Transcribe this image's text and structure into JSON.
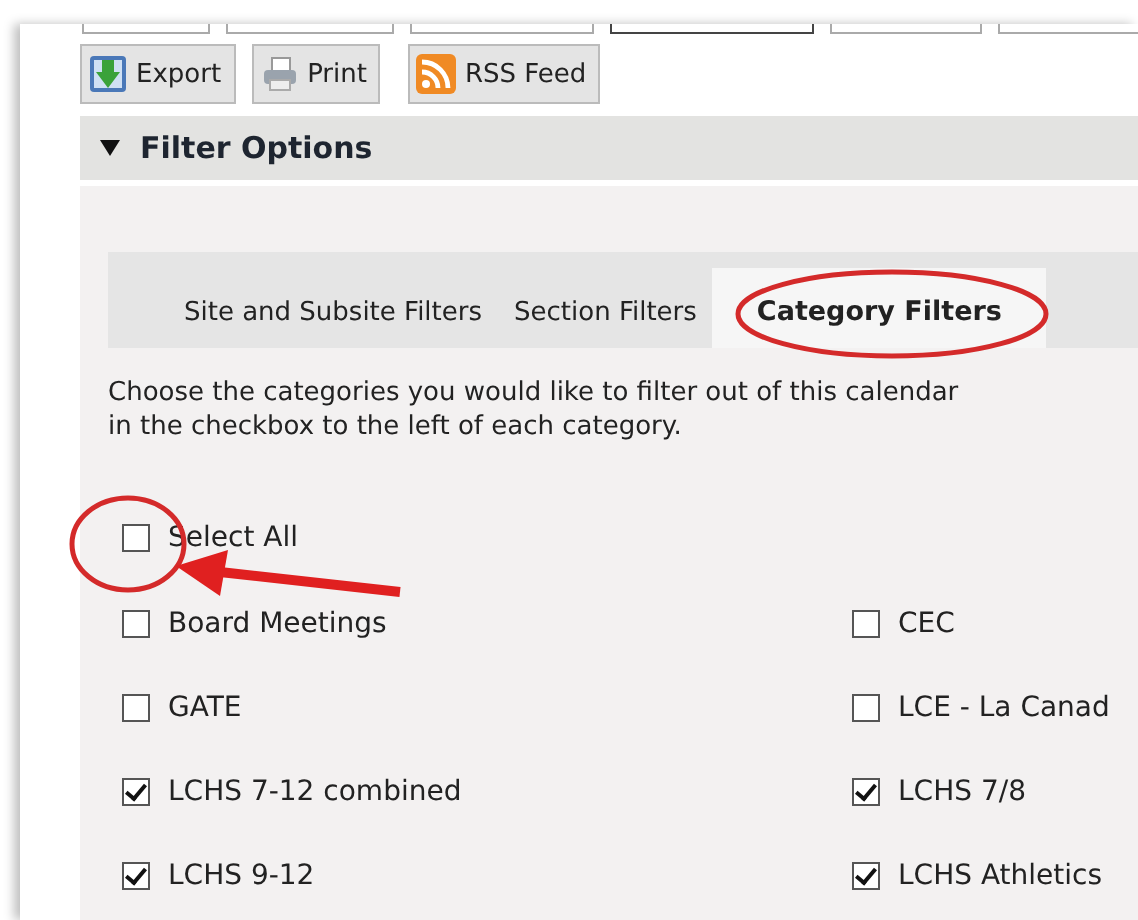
{
  "toolbar": [
    {
      "label": "Export",
      "kind": "export"
    },
    {
      "label": "Print",
      "kind": "print"
    },
    {
      "label": "RSS Feed",
      "kind": "rss"
    }
  ],
  "filter_options": {
    "title": "Filter Options",
    "expanded": true
  },
  "tabs": [
    {
      "label": "Site and Subsite Filters",
      "selected": false
    },
    {
      "label": "Section Filters",
      "selected": false
    },
    {
      "label": "Category Filters",
      "selected": true
    }
  ],
  "instructions": [
    "Choose the categories you would like to filter out of this calendar",
    "in the checkbox to the left of each category."
  ],
  "select_all": {
    "label": "Select All",
    "checked": false
  },
  "categories": [
    {
      "label": "Board Meetings",
      "checked": false
    },
    {
      "label": "CEC",
      "checked": false
    },
    {
      "label": "GATE",
      "checked": false
    },
    {
      "label": "LCE - La Canad",
      "checked": false
    },
    {
      "label": "LCHS 7-12 combined",
      "checked": true
    },
    {
      "label": "LCHS 7/8",
      "checked": true
    },
    {
      "label": "LCHS 9-12",
      "checked": true
    },
    {
      "label": "LCHS Athletics",
      "checked": true
    }
  ]
}
